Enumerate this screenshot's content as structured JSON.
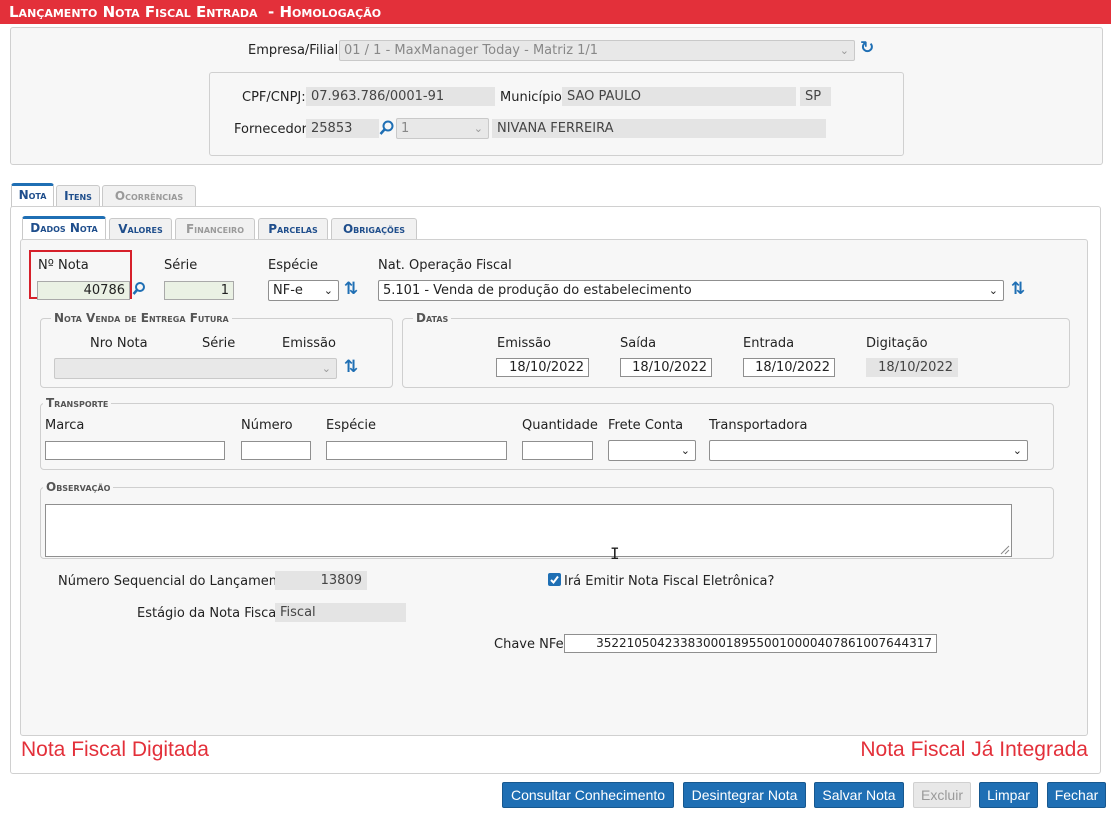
{
  "title": "Lançamento Nota Fiscal Entrada",
  "title_suffix": "- Homologação",
  "header": {
    "empresa_label": "Empresa/Filial:",
    "empresa_value": "01 / 1 - MaxManager Today - Matriz 1/1",
    "cpf_label": "CPF/CNPJ:",
    "cpf_value": "07.963.786/0001-91",
    "municipio_label": "Município:",
    "municipio_value": "SAO PAULO",
    "uf_value": "SP",
    "fornecedor_label": "Fornecedor:",
    "fornecedor_code": "25853",
    "fornecedor_sub": "1",
    "fornecedor_name": "NIVANA FERREIRA"
  },
  "tabs": [
    "Nota",
    "Itens",
    "Ocorrências"
  ],
  "subtabs": [
    "Dados Nota",
    "Valores",
    "Financeiro",
    "Parcelas",
    "Obrigações"
  ],
  "nota": {
    "numero_label": "Nº Nota",
    "numero_value": "40786",
    "serie_label": "Série",
    "serie_value": "1",
    "especie_label": "Espécie",
    "especie_value": "NF-e",
    "natop_label": "Nat. Operação Fiscal",
    "natop_value": "5.101 - Venda de produção do estabelecimento"
  },
  "venda_futura": {
    "legend": "Nota Venda de Entrega Futura",
    "nro_label": "Nro Nota",
    "serie_label": "Série",
    "emissao_label": "Emissão"
  },
  "datas": {
    "legend": "Datas",
    "emissao_label": "Emissão",
    "emissao_value": "18/10/2022",
    "saida_label": "Saída",
    "saida_value": "18/10/2022",
    "entrada_label": "Entrada",
    "entrada_value": "18/10/2022",
    "digitacao_label": "Digitação",
    "digitacao_value": "18/10/2022"
  },
  "transporte": {
    "legend": "Transporte",
    "marca_label": "Marca",
    "numero_label": "Número",
    "especie_label": "Espécie",
    "quantidade_label": "Quantidade",
    "frete_label": "Frete Conta",
    "transportadora_label": "Transportadora"
  },
  "observacao": {
    "legend": "Observação"
  },
  "footer_info": {
    "seq_label": "Número Sequencial do Lançamento:",
    "seq_value": "13809",
    "estagio_label": "Estágio da Nota Fiscal:",
    "estagio_value": "Fiscal",
    "nfe_checkbox_label": "Irá Emitir Nota Fiscal Eletrônica?",
    "nfe_checked": true,
    "chave_label": "Chave NFe:",
    "chave_value": "35221050423383000189550010000407861007644317"
  },
  "status": {
    "left": "Nota Fiscal Digitada",
    "right": "Nota Fiscal Já Integrada"
  },
  "buttons": {
    "consultar": "Consultar Conhecimento",
    "desintegrar": "Desintegrar Nota",
    "salvar": "Salvar Nota",
    "excluir": "Excluir",
    "limpar": "Limpar",
    "fechar": "Fechar"
  },
  "colors": {
    "title_bar": "#e3303a",
    "accent_blue": "#1f6fb4",
    "status_red": "#e3303a",
    "highlight_box": "#d6202a"
  }
}
